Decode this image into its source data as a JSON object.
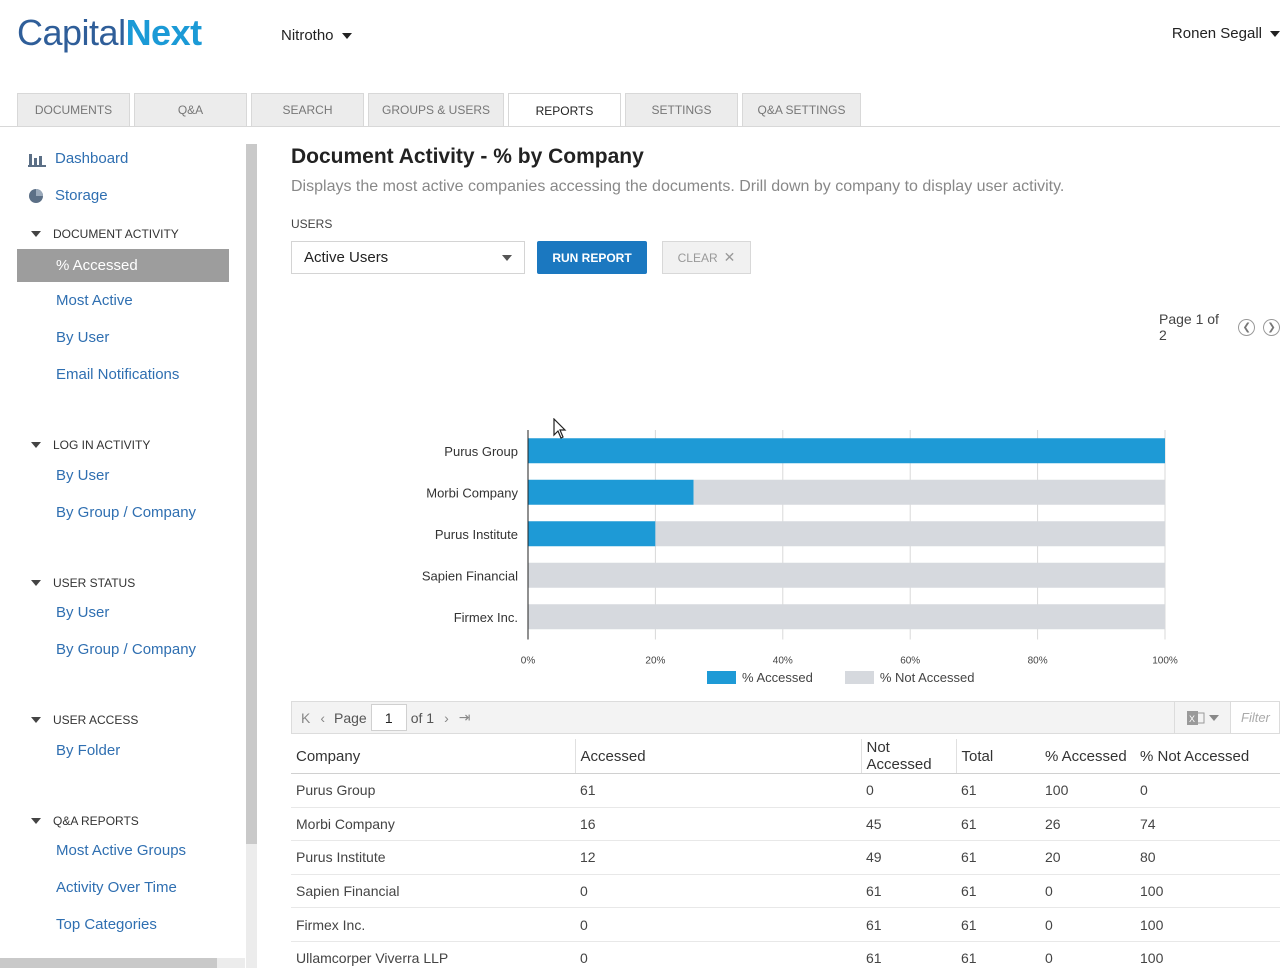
{
  "app": {
    "logo_part1": "Capital",
    "logo_part2": "Next",
    "workspace": "Nitrotho",
    "user_name": "Ronen Segall"
  },
  "tabs": [
    {
      "label": "DOCUMENTS",
      "active": false
    },
    {
      "label": "Q&A",
      "active": false
    },
    {
      "label": "SEARCH",
      "active": false
    },
    {
      "label": "GROUPS & USERS",
      "active": false
    },
    {
      "label": "REPORTS",
      "active": true
    },
    {
      "label": "SETTINGS",
      "active": false
    },
    {
      "label": "Q&A SETTINGS",
      "active": false
    }
  ],
  "sidebar": {
    "dashboard": "Dashboard",
    "storage": "Storage",
    "sections": [
      {
        "label": "DOCUMENT ACTIVITY",
        "items": [
          "% Accessed",
          "Most Active",
          "By User",
          "Email Notifications"
        ]
      },
      {
        "label": "LOG IN ACTIVITY",
        "items": [
          "By User",
          "By Group / Company"
        ]
      },
      {
        "label": "USER STATUS",
        "items": [
          "By User",
          "By Group / Company"
        ]
      },
      {
        "label": "USER ACCESS",
        "items": [
          "By Folder"
        ]
      },
      {
        "label": "Q&A REPORTS",
        "items": [
          "Most Active Groups",
          "Activity Over Time",
          "Top Categories"
        ]
      }
    ]
  },
  "report": {
    "title": "Document Activity - % by Company",
    "description": "Displays the most active companies accessing the documents. Drill down by company to display user activity.",
    "users_label": "USERS",
    "users_value": "Active Users",
    "run_label": "RUN REPORT",
    "clear_label": "CLEAR",
    "page_info": "Page 1 of 2"
  },
  "colors": {
    "accessed": "#1e9ad6",
    "not_accessed": "#d6d9de",
    "brand_dark": "#2f5e99",
    "link": "#2f6fb1"
  },
  "chart_data": {
    "type": "bar",
    "orientation": "horizontal",
    "stacked": true,
    "categories": [
      "Purus Group",
      "Morbi Company",
      "Purus Institute",
      "Sapien Financial",
      "Firmex Inc."
    ],
    "series": [
      {
        "name": "% Accessed",
        "values": [
          100,
          26,
          20,
          0,
          0
        ]
      },
      {
        "name": "% Not Accessed",
        "values": [
          0,
          74,
          80,
          100,
          100
        ]
      }
    ],
    "xlim": [
      0,
      100
    ],
    "xticks": [
      "0%",
      "20%",
      "40%",
      "60%",
      "80%",
      "100%"
    ],
    "grid": true,
    "legend": "bottom"
  },
  "grid": {
    "page_label": "Page",
    "page_value": "1",
    "of_label": "of 1",
    "filter_placeholder": "Filter",
    "columns": [
      "Company",
      "Accessed",
      "Not Accessed",
      "Total",
      "% Accessed",
      "% Not Accessed"
    ],
    "rows": [
      [
        "Purus Group",
        "61",
        "0",
        "61",
        "100",
        "0"
      ],
      [
        "Morbi Company",
        "16",
        "45",
        "61",
        "26",
        "74"
      ],
      [
        "Purus Institute",
        "12",
        "49",
        "61",
        "20",
        "80"
      ],
      [
        "Sapien Financial",
        "0",
        "61",
        "61",
        "0",
        "100"
      ],
      [
        "Firmex Inc.",
        "0",
        "61",
        "61",
        "0",
        "100"
      ],
      [
        "Ullamcorper Viverra LLP",
        "0",
        "61",
        "61",
        "0",
        "100"
      ]
    ]
  }
}
